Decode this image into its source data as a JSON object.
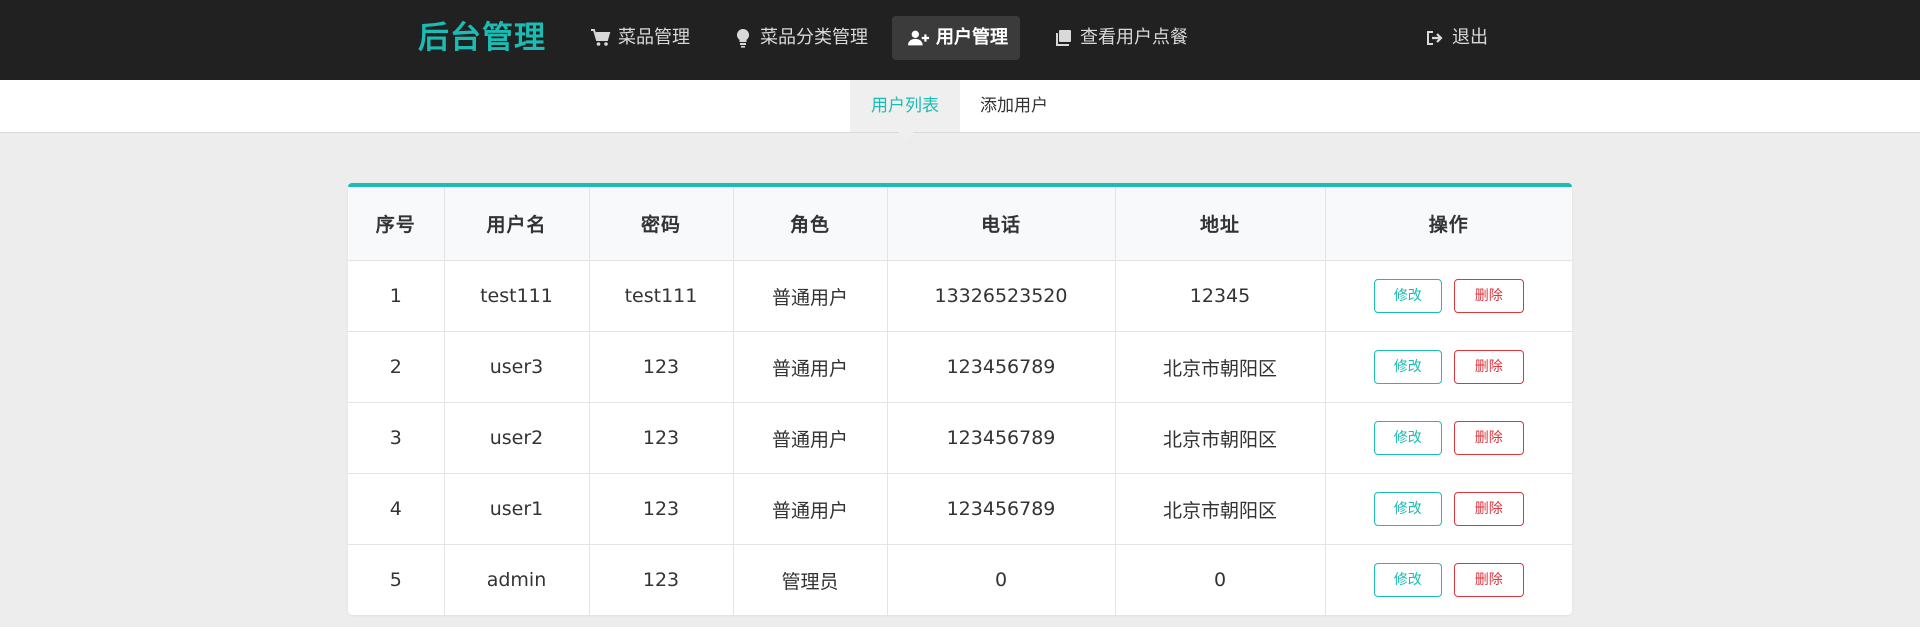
{
  "header": {
    "brand": "后台管理",
    "nav": [
      {
        "label": "菜品管理",
        "icon": "cart-icon",
        "active": false
      },
      {
        "label": "菜品分类管理",
        "icon": "lightbulb-icon",
        "active": false
      },
      {
        "label": "用户管理",
        "icon": "add-user-icon",
        "active": true
      },
      {
        "label": "查看用户点餐",
        "icon": "copy-icon",
        "active": false
      }
    ],
    "logout": {
      "label": "退出",
      "icon": "sign-out-icon"
    }
  },
  "subnav": {
    "tabs": [
      {
        "label": "用户列表",
        "active": true
      },
      {
        "label": "添加用户",
        "active": false
      }
    ]
  },
  "table": {
    "columns": [
      "序号",
      "用户名",
      "密码",
      "角色",
      "电话",
      "地址",
      "操作"
    ],
    "rows": [
      {
        "index": "1",
        "username": "test111",
        "password": "test111",
        "role": "普通用户",
        "phone": "13326523520",
        "address": "12345"
      },
      {
        "index": "2",
        "username": "user3",
        "password": "123",
        "role": "普通用户",
        "phone": "123456789",
        "address": "北京市朝阳区"
      },
      {
        "index": "3",
        "username": "user2",
        "password": "123",
        "role": "普通用户",
        "phone": "123456789",
        "address": "北京市朝阳区"
      },
      {
        "index": "4",
        "username": "user1",
        "password": "123",
        "role": "普通用户",
        "phone": "123456789",
        "address": "北京市朝阳区"
      },
      {
        "index": "5",
        "username": "admin",
        "password": "123",
        "role": "管理员",
        "phone": "0",
        "address": "0"
      }
    ],
    "actions": {
      "edit_label": "修改",
      "delete_label": "删除"
    }
  },
  "colors": {
    "accent": "#1bbcb4",
    "danger": "#d9363e",
    "topbar": "#212121"
  }
}
